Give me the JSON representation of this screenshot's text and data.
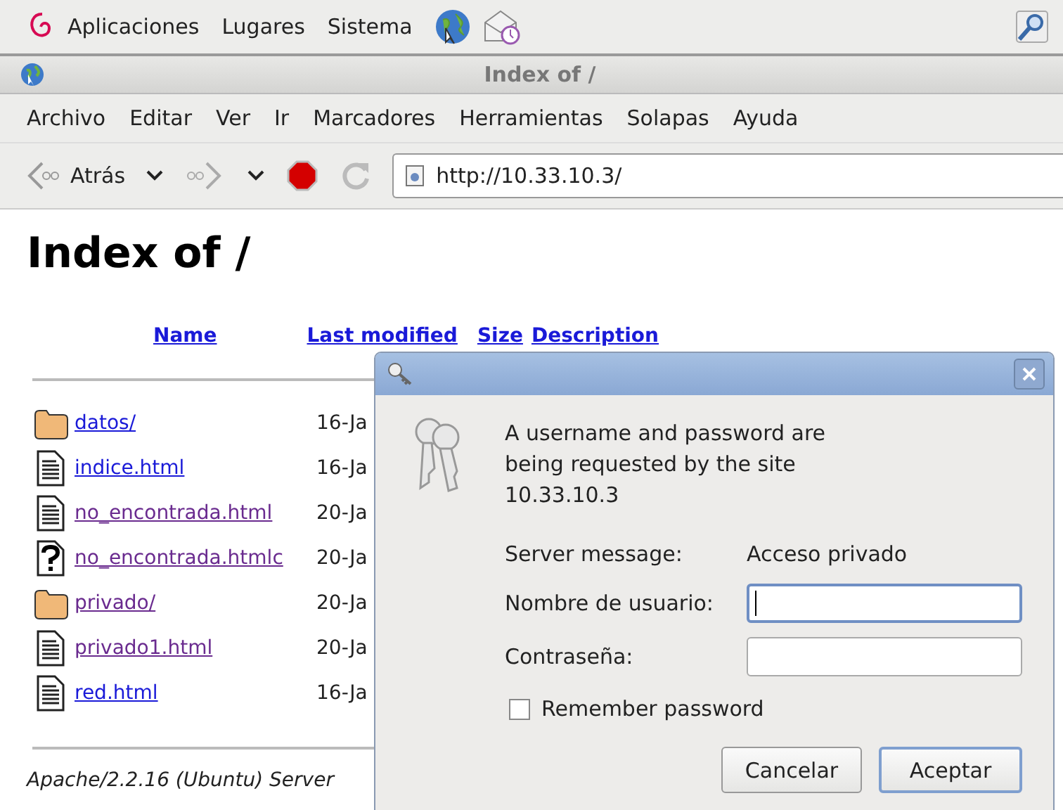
{
  "panel": {
    "menus": [
      "Aplicaciones",
      "Lugares",
      "Sistema"
    ]
  },
  "window": {
    "title": "Index of /"
  },
  "menubar": [
    {
      "label": "Archivo"
    },
    {
      "label": "Editar"
    },
    {
      "label": "Ver"
    },
    {
      "label": "Ir"
    },
    {
      "label": "Marcadores"
    },
    {
      "label": "Herramientas"
    },
    {
      "label": "Solapas"
    },
    {
      "label": "Ayuda"
    }
  ],
  "toolbar": {
    "back_label": "Atrás",
    "url": "http://10.33.10.3/"
  },
  "page": {
    "heading": "Index of /",
    "columns": [
      "Name",
      "Last modified",
      "Size",
      "Description"
    ],
    "rows": [
      {
        "kind": "folder",
        "name": "datos/",
        "visited": false,
        "modified": "16-Ja"
      },
      {
        "kind": "text",
        "name": "indice.html",
        "visited": false,
        "modified": "16-Ja"
      },
      {
        "kind": "text",
        "name": "no_encontrada.html",
        "visited": true,
        "modified": "20-Ja"
      },
      {
        "kind": "unknown",
        "name": "no_encontrada.htmlc",
        "visited": true,
        "modified": "20-Ja"
      },
      {
        "kind": "folder",
        "name": "privado/",
        "visited": true,
        "modified": "20-Ja"
      },
      {
        "kind": "text",
        "name": "privado1.html",
        "visited": true,
        "modified": "20-Ja"
      },
      {
        "kind": "text",
        "name": "red.html",
        "visited": false,
        "modified": "16-Ja"
      }
    ],
    "footer": "Apache/2.2.16 (Ubuntu) Server"
  },
  "dialog": {
    "message": "A username and password are being requested by the site 10.33.10.3",
    "server_label": "Server message:",
    "server_value": "Acceso privado",
    "fields": [
      {
        "label": "Nombre de usuario:",
        "focused": true
      },
      {
        "label": "Contraseña:",
        "focused": false
      }
    ],
    "remember": {
      "label": "Remember password",
      "checked": false
    },
    "buttons": [
      {
        "label": "Cancelar",
        "default": false
      },
      {
        "label": "Aceptar",
        "default": true
      }
    ]
  }
}
